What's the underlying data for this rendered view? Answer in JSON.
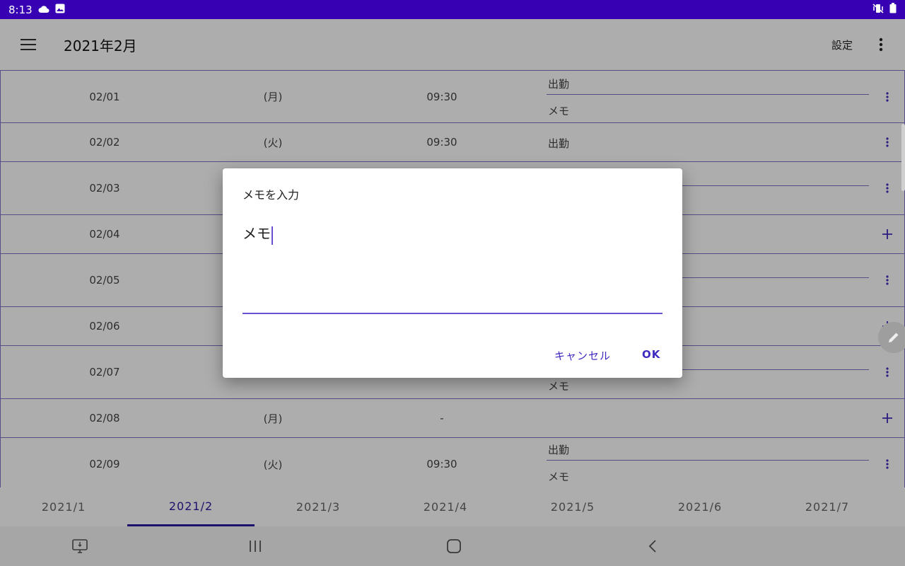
{
  "status_bar": {
    "time": "8:13",
    "left_icons": [
      "cloud-icon",
      "gallery-icon"
    ],
    "right_icons": [
      "vibrate-mute-icon",
      "battery-icon"
    ],
    "background": "#3700b3"
  },
  "app_bar": {
    "title": "2021年2月",
    "settings_label": "設定"
  },
  "rows": [
    {
      "date": "02/01",
      "weekday": "(月)",
      "time": "09:30",
      "status": "出勤",
      "memo": "メモ",
      "action": "more"
    },
    {
      "date": "02/02",
      "weekday": "(火)",
      "time": "09:30",
      "status": "出勤",
      "memo": "",
      "action": "more"
    },
    {
      "date": "02/03",
      "weekday": "",
      "time": "",
      "status": "",
      "memo": "",
      "action": "more"
    },
    {
      "date": "02/04",
      "weekday": "",
      "time": "",
      "status": "",
      "memo": "",
      "action": "add"
    },
    {
      "date": "02/05",
      "weekday": "",
      "time": "",
      "status": "",
      "memo": "",
      "action": "more"
    },
    {
      "date": "02/06",
      "weekday": "",
      "time": "",
      "status": "",
      "memo": "",
      "action": "add"
    },
    {
      "date": "02/07",
      "weekday": "",
      "time": "",
      "status": "",
      "memo": "メモ",
      "action": "more"
    },
    {
      "date": "02/08",
      "weekday": "(月)",
      "time": "-",
      "status": "",
      "memo": "",
      "action": "add"
    },
    {
      "date": "02/09",
      "weekday": "(火)",
      "time": "09:30",
      "status": "出勤",
      "memo": "メモ",
      "action": "more"
    }
  ],
  "tabs": [
    {
      "label": "2021/1",
      "active": false
    },
    {
      "label": "2021/2",
      "active": true
    },
    {
      "label": "2021/3",
      "active": false
    },
    {
      "label": "2021/4",
      "active": false
    },
    {
      "label": "2021/5",
      "active": false
    },
    {
      "label": "2021/6",
      "active": false
    },
    {
      "label": "2021/7",
      "active": false
    }
  ],
  "dialog": {
    "title": "メモを入力",
    "input_value": "メモ",
    "cancel_label": "キャンセル",
    "ok_label": "OK"
  },
  "nav_icons": [
    "screenshot-icon",
    "recents-icon",
    "home-icon",
    "back-icon"
  ],
  "colors": {
    "accent": "#3700b3",
    "row_border": "#7e74c8",
    "dialog_button": "#3f2ac0",
    "active_tab": "#2a1aa0"
  }
}
